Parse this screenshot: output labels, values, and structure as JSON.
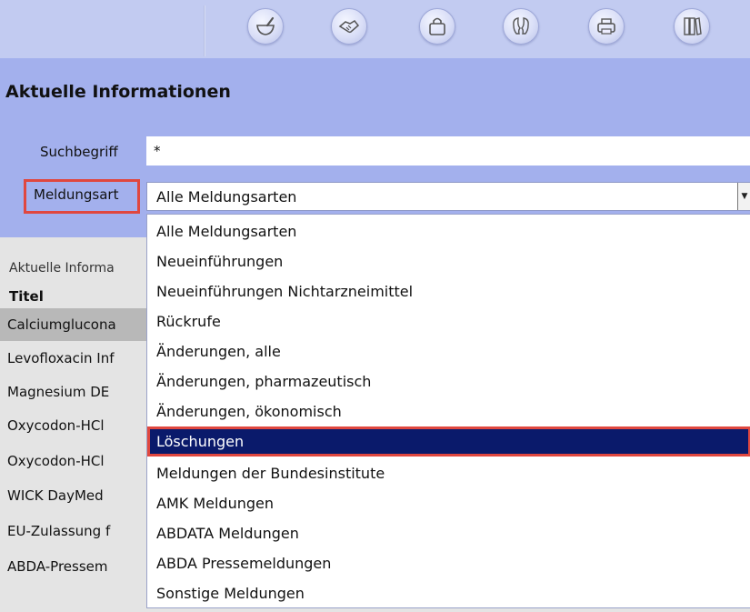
{
  "toolbar": {
    "icons": [
      "mortar-pestle-icon",
      "handshake-icon",
      "shopping-bag-icon",
      "faces-icon",
      "printer-icon",
      "binders-icon"
    ]
  },
  "page_title": "Aktuelle Informationen",
  "search": {
    "label": "Suchbegriff",
    "value": "*"
  },
  "message_type": {
    "label": "Meldungsart",
    "selected": "Alle Meldungsarten",
    "arrow": "▼"
  },
  "dropdown": {
    "options": [
      "Alle Meldungsarten",
      "Neueinführungen",
      "Neueinführungen Nichtarzneimittel",
      "Rückrufe",
      "Änderungen, alle",
      "Änderungen, pharmazeutisch",
      "Änderungen, ökonomisch",
      "Löschungen",
      "Meldungen der Bundesinstitute",
      "AMK Meldungen",
      "ABDATA Meldungen",
      "ABDA Pressemeldungen",
      "Sonstige Meldungen"
    ],
    "highlighted_index": 7
  },
  "results": {
    "caption": "Aktuelle Informa",
    "column_title": "Titel",
    "rows": [
      "Calciumglucona",
      "Levofloxacin Inf",
      "Magnesium DE",
      "Oxycodon-HCl",
      "Oxycodon-HCl",
      "WICK DayMed",
      "EU-Zulassung f",
      "ABDA-Pressem"
    ]
  },
  "colors": {
    "header_bg": "#a3b0ed",
    "toolbar_bg": "#c2cbf1",
    "highlight_bg": "#0a1a6b",
    "highlight_border": "#e0473f",
    "selected_row_bg": "#b8b8b8"
  }
}
